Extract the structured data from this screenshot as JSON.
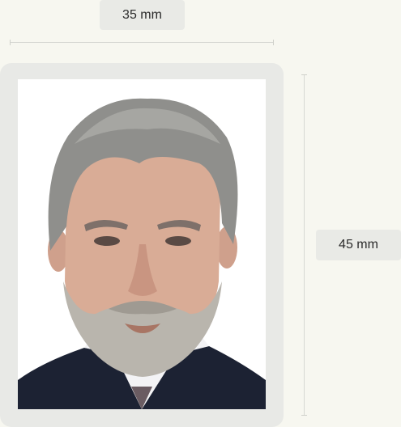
{
  "dimensions": {
    "width_label": "35 mm",
    "height_label": "45 mm"
  },
  "photo": {
    "subject": "passport-photo-portrait",
    "background_color": "#ffffff"
  },
  "colors": {
    "page_background": "#f7f7f0",
    "frame": "#e8e9e6",
    "label_background": "#e9eae6",
    "guide_line": "#d7d8d3"
  }
}
